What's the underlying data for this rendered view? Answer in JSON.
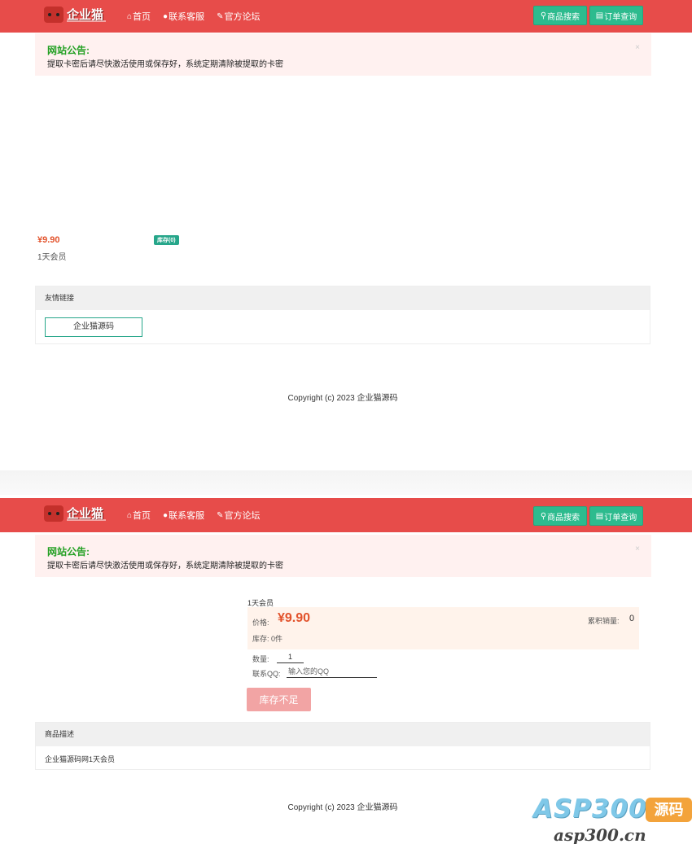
{
  "brand": {
    "logo_text": "企业猫"
  },
  "nav": {
    "home": "首页",
    "service": "联系客服",
    "forum": "官方论坛"
  },
  "header_buttons": {
    "search": "商品搜索",
    "order": "订单查询"
  },
  "notice": {
    "title": "网站公告:",
    "body": "提取卡密后请尽快激活使用或保存好，系统定期清除被提取的卡密",
    "close": "×"
  },
  "listing": {
    "price": "¥9.90",
    "stock_badge": "库存(0)",
    "name": "1天会员"
  },
  "links_panel": {
    "title": "友情链接",
    "items": [
      "企业猫源码"
    ]
  },
  "footer": {
    "copyright": "Copyright (c) 2023 企业猫源码"
  },
  "detail": {
    "name": "1天会员",
    "price_label": "价格:",
    "price": "¥9.90",
    "sales_label": "累积销量:",
    "sales": "0",
    "stock_text": "库存: 0件",
    "qty_label": "数量:",
    "qty_value": "1",
    "qq_label": "联系QQ:",
    "qq_placeholder": "输入您的QQ",
    "buy_button": "库存不足",
    "desc_title": "商品描述",
    "desc_body": "企业猫源码网1天会员"
  },
  "watermark": {
    "brand": "ASP300",
    "tag": "源码",
    "url": "asp300.cn"
  },
  "colors": {
    "navbar": "#e74c4a",
    "accent_green": "#2dbb8e",
    "price": "#e2522b",
    "notice_title": "#24a024"
  }
}
